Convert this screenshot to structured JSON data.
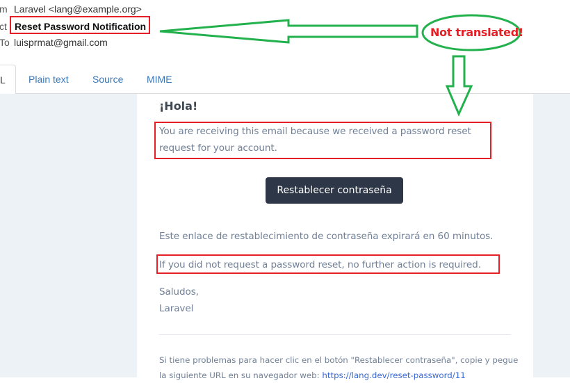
{
  "header": {
    "from_label": "m",
    "from_value": "Laravel <lang@example.org>",
    "subject_label": "ct",
    "subject_value": "Reset Password Notification",
    "to_label": "To",
    "to_value": "luisprmat@gmail.com"
  },
  "tabs": [
    {
      "label": "L",
      "active": true
    },
    {
      "label": "Plain text",
      "active": false
    },
    {
      "label": "Source",
      "active": false
    },
    {
      "label": "MIME",
      "active": false
    }
  ],
  "email": {
    "greeting": "¡Hola!",
    "intro": "You are receiving this email because we received a password reset request for your account.",
    "button_label": "Restablecer contraseña",
    "expire": "Este enlace de restablecimiento de contraseña expirará en 60 minutos.",
    "no_action": "If you did not request a password reset, no further action is required.",
    "salutation": "Saludos,",
    "signature": "Laravel",
    "subcopy_text": "Si tiene problemas para hacer clic en el botón \"Restablecer contraseña\", copie y pegue la siguiente URL en su navegador web: ",
    "subcopy_link": "https://lang.dev/reset-password/11"
  },
  "annotation": {
    "callout": "Not translated!",
    "arrow_color": "#22b14c",
    "highlight_color": "#e61e25"
  }
}
